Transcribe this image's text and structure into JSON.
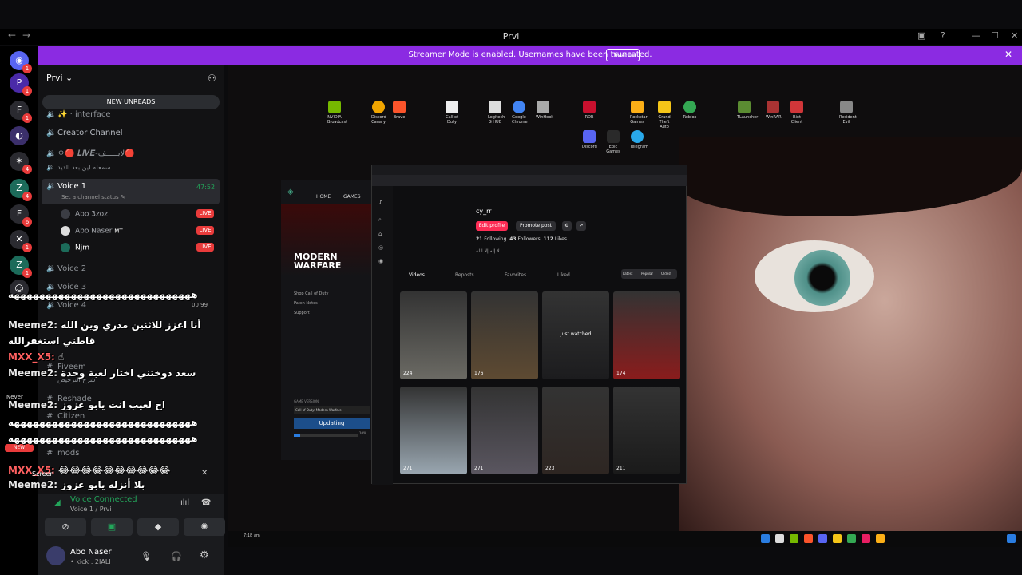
{
  "window": {
    "title": "Prvi"
  },
  "streamer_banner": {
    "message": "Streamer Mode is enabled. Usernames have been truncated.",
    "disable_label": "Disable"
  },
  "server_badges": [
    "1",
    "1",
    "1",
    "4",
    "4",
    "6",
    "1",
    "1"
  ],
  "guild": {
    "name": "Prvi"
  },
  "new_unreads": "NEW UNREADS",
  "channels": {
    "interface": "✨ · interface",
    "creator": "Creator Channel",
    "live": "ㅇ🔴 𝑳𝑰𝑽𝑬-لايـــــف🔴",
    "arabic": "سمعله لين بعد الديد",
    "voice1": "Voice 1",
    "voice1_time": "47:52",
    "voice1_status": "Set a channel status",
    "voice2": "Voice 2",
    "voice3": "Voice 3",
    "voice4": "Voice 4",
    "voice4_counts": "00  99",
    "fiveem": "Fiveem",
    "sub_arabic": "شرح الترخيص",
    "reshade": "Reshade",
    "citizen": "Citizen",
    "mods": "mods"
  },
  "voice_users": [
    {
      "name": "Abo 3zoz",
      "badge": "LIVE"
    },
    {
      "name": "Abo Naser",
      "extra": "MT",
      "badge": "LIVE"
    },
    {
      "name": "Njm",
      "badge": "LIVE"
    }
  ],
  "chat_overlay": [
    {
      "name": "",
      "text": "هههههههههههههههههههههههههههههه"
    },
    {
      "name": "Meeme2:",
      "text": "أنا اعزز للاثنين مدري وين الله"
    },
    {
      "name": "",
      "text": "قاطني استغفرالله"
    },
    {
      "name": "MXX_X5:",
      "text": "☝"
    },
    {
      "name": "Meeme2:",
      "text": "سعد دوختني اختار لعبة وحدة"
    },
    {
      "name": "Meeme2:",
      "text": "اح لعيب انت يابو عزوز"
    },
    {
      "name": "",
      "text": "هههههههههههههههههههههههههههههه"
    },
    {
      "name": "",
      "text": "هههههههههههههههههههههههههههههه"
    },
    {
      "name": "MXX_X5:",
      "text": "😂😂😂😂😂😂😂😂😂😂"
    },
    {
      "name": "Meeme2:",
      "text": "بلا أنزله يابو عزوز"
    }
  ],
  "never_label": "Never",
  "screen_label": "Screen",
  "voice_status": {
    "connected": "Voice Connected",
    "channel": "Voice 1 / Prvi"
  },
  "user": {
    "name": "Abo Naser",
    "status": "• kick : 2IALI"
  },
  "stream": {
    "desktop_icons": [
      "NVIDIA Broadcast",
      "Discord Canary",
      "Brave",
      "Call of Duty",
      "Logitech G HUB",
      "Google Chrome",
      "WinHook",
      "RDR",
      "Rockstar Games",
      "Grand Theft Auto",
      "Roblox",
      "TLauncher",
      "WinRAR",
      "Riot Client",
      "Resident Evil",
      "Discord",
      "Epic Games",
      "Telegram"
    ],
    "mw_title": "MODERN WARFARE",
    "mw_nav": [
      "HOME",
      "GAMES"
    ],
    "mw_links": [
      "Shop Call of Duty",
      "Patch Notes",
      "Support"
    ],
    "mw_version_label": "GAME VERSION",
    "mw_version": "Call of Duty: Modern Warfare",
    "mw_update": "Updating",
    "mw_progress_pct": "10%",
    "tiktok": {
      "username": "cy_rr",
      "edit_profile": "Edit profile",
      "promote": "Promote post",
      "following": "21",
      "following_label": "Following",
      "followers": "43",
      "followers_label": "Followers",
      "likes": "112",
      "likes_label": "Likes",
      "bio": "لا إله إلا الله",
      "tabs": [
        "Videos",
        "Reposts",
        "Favorites",
        "Liked"
      ],
      "sorts": [
        "Latest",
        "Popular",
        "Oldest"
      ],
      "tiles": [
        {
          "views": "224",
          "overlay": "",
          "color": "#6b6a64"
        },
        {
          "views": "176",
          "overlay": "",
          "color": "#5e4a32"
        },
        {
          "views": "",
          "overlay": "Just watched",
          "color": "#1c1c1e"
        },
        {
          "views": "174",
          "overlay": "",
          "color": "#8a1c1c"
        },
        {
          "views": "271",
          "overlay": "",
          "color": "#9aa7b1"
        },
        {
          "views": "271",
          "overlay": "",
          "color": "#5a5660"
        },
        {
          "views": "223",
          "overlay": "",
          "color": "#2e2622"
        },
        {
          "views": "211",
          "overlay": "",
          "color": "#1a1a1a"
        }
      ]
    },
    "taskbar_time": "7:18 am"
  }
}
